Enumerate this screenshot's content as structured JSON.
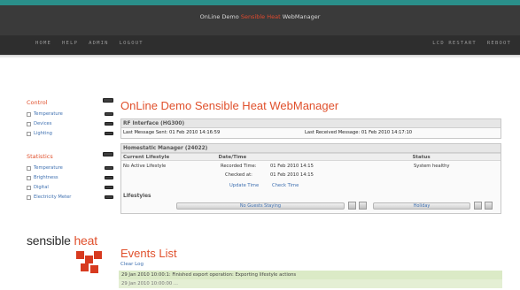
{
  "app": {
    "title_prefix": "OnLine Demo ",
    "title_accent": "Sensible Heat",
    "title_suffix": " WebManager"
  },
  "nav": {
    "left": [
      "HOME",
      "HELP",
      "ADMIN",
      "LOGOUT"
    ],
    "right": [
      "LCD RESTART",
      "REBOOT"
    ]
  },
  "sidebar": {
    "control": {
      "title": "Control",
      "items": [
        "Temperature",
        "Devices",
        "Lighting"
      ]
    },
    "statistics": {
      "title": "Statistics",
      "items": [
        "Temperature",
        "Brightness",
        "Digital",
        "Electricity Meter"
      ]
    }
  },
  "logo": {
    "word1": "sensible ",
    "word2": "heat"
  },
  "main": {
    "title": "OnLine Demo Sensible Heat WebManager",
    "rf": {
      "header": "RF Interface (HG300)",
      "last_sent": "Last Message Sent: 01 Feb 2010 14:16:59",
      "last_received": "Last Received Message: 01 Feb 2010 14:17:10"
    },
    "homestatic": {
      "header": "Homestatic Manager (24022)",
      "columns": [
        "Current Lifestyle",
        "Date/Time",
        "Status"
      ],
      "lifestyle": "No Active Lifestyle",
      "recorded_label": "Recorded Time:",
      "recorded_value": "01 Feb 2010 14:15",
      "checked_label": "Checked at:",
      "checked_value": "01 Feb 2010 14:15",
      "status": "System healthy",
      "update_link": "Update Time",
      "check_link": "Check Time"
    },
    "lifestyles": {
      "header": "Lifestyles",
      "btn1": "No Guests Staying",
      "btn2": "Holiday"
    }
  },
  "events": {
    "title": "Events List",
    "clear": "Clear Log",
    "rows": [
      "29 Jan 2010 10:00:1:   Finished export operation: Exporting lifestyle actions",
      "29 Jan 2010 10:00:00   ..."
    ]
  },
  "colors": {
    "accent": "#e0502c",
    "link": "#3d6fb0",
    "topbar": "#3a3a3a",
    "stripe": "#2a8f8a"
  }
}
